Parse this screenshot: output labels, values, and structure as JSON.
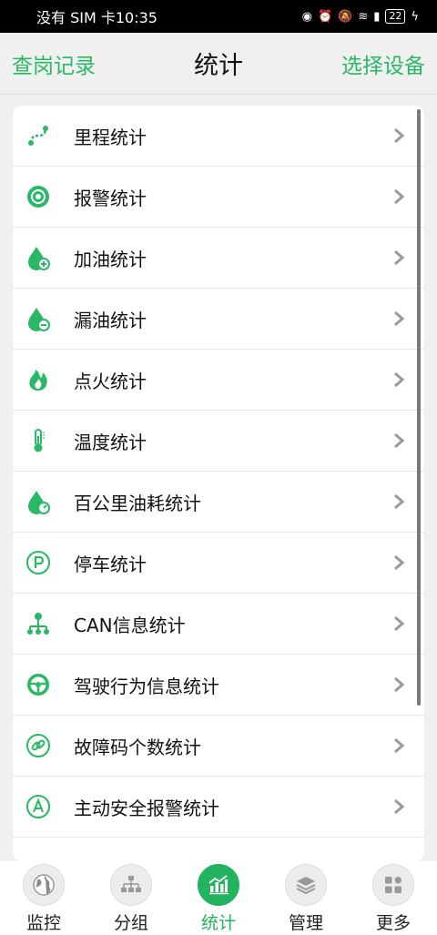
{
  "status_bar": {
    "left_text": "没有 SIM 卡10:35",
    "battery": "22"
  },
  "header": {
    "left_link": "查岗记录",
    "title": "统计",
    "right_link": "选择设备"
  },
  "menu": {
    "items": [
      {
        "label": "里程统计",
        "icon": "route-icon"
      },
      {
        "label": "报警统计",
        "icon": "alarm-icon"
      },
      {
        "label": "加油统计",
        "icon": "oil-plus-icon"
      },
      {
        "label": "漏油统计",
        "icon": "oil-minus-icon"
      },
      {
        "label": "点火统计",
        "icon": "fire-icon"
      },
      {
        "label": "温度统计",
        "icon": "thermometer-icon"
      },
      {
        "label": "百公里油耗统计",
        "icon": "oil-gauge-icon"
      },
      {
        "label": "停车统计",
        "icon": "parking-icon"
      },
      {
        "label": "CAN信息统计",
        "icon": "network-icon"
      },
      {
        "label": "驾驶行为信息统计",
        "icon": "steering-wheel-icon"
      },
      {
        "label": "故障码个数统计",
        "icon": "link-icon"
      },
      {
        "label": "主动安全报警统计",
        "icon": "letter-a-icon"
      }
    ]
  },
  "tabs": [
    {
      "label": "监控",
      "icon": "globe-icon",
      "active": false
    },
    {
      "label": "分组",
      "icon": "hierarchy-icon",
      "active": false
    },
    {
      "label": "统计",
      "icon": "bar-chart-icon",
      "active": true
    },
    {
      "label": "管理",
      "icon": "layers-icon",
      "active": false
    },
    {
      "label": "更多",
      "icon": "grid-icon",
      "active": false
    }
  ],
  "colors": {
    "accent": "#29b866",
    "active_tab": "#22b35e"
  }
}
